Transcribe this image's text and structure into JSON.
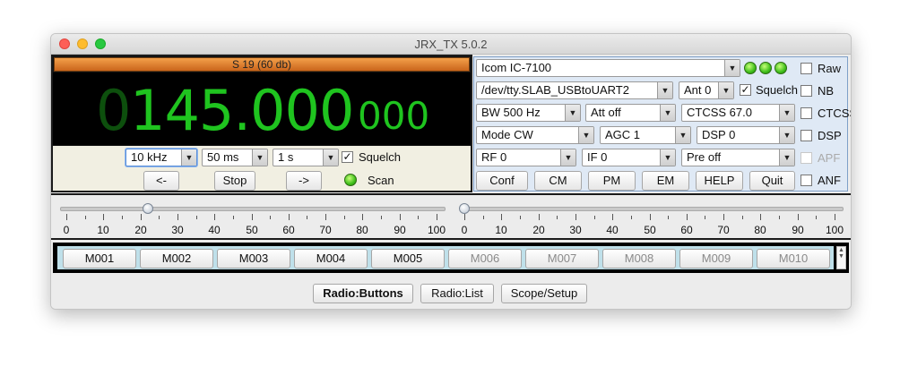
{
  "window": {
    "title": "JRX_TX 5.0.2"
  },
  "smeter": {
    "text": "S 19 (60 db)"
  },
  "frequency": {
    "leading": "0",
    "main": "145.000",
    "fine": "000"
  },
  "scan_controls": {
    "step": "10 kHz",
    "delay": "50 ms",
    "dwell": "1 s",
    "squelch_label": "Squelch",
    "squelch_checked": true,
    "prev_label": "<-",
    "stop_label": "Stop",
    "next_label": "->",
    "scan_label": "Scan"
  },
  "radio_panel": {
    "radio_model": "Icom IC-7100",
    "port": "/dev/tty.SLAB_USBtoUART2",
    "antenna": "Ant 0",
    "squelch_label": "Squelch",
    "bandwidth": "BW 500 Hz",
    "attenuator": "Att off",
    "ctcss_tone": "CTCSS 67.0",
    "mode": "Mode CW",
    "agc": "AGC 1",
    "dsp": "DSP 0",
    "rf": "RF 0",
    "if": "IF 0",
    "preamp": "Pre off",
    "buttons": [
      "Conf",
      "CM",
      "PM",
      "EM",
      "HELP",
      "Quit"
    ],
    "checkboxes": [
      "Raw",
      "NB",
      "CTCSS",
      "DSP",
      "APF",
      "ANF"
    ],
    "led_color": "#3fbf1b"
  },
  "sliders": {
    "left_ticks": [
      "0",
      "10",
      "20",
      "30",
      "40",
      "50",
      "60",
      "70",
      "80",
      "90",
      "100"
    ],
    "right_ticks": [
      "0",
      "10",
      "20",
      "30",
      "40",
      "50",
      "60",
      "70",
      "80",
      "90",
      "100"
    ],
    "left_value": 22,
    "right_value": 0
  },
  "memories": [
    "M001",
    "M002",
    "M003",
    "M004",
    "M005",
    "M006",
    "M007",
    "M008",
    "M009",
    "M010"
  ],
  "tabs": [
    "Radio:Buttons",
    "Radio:List",
    "Scope/Setup"
  ]
}
